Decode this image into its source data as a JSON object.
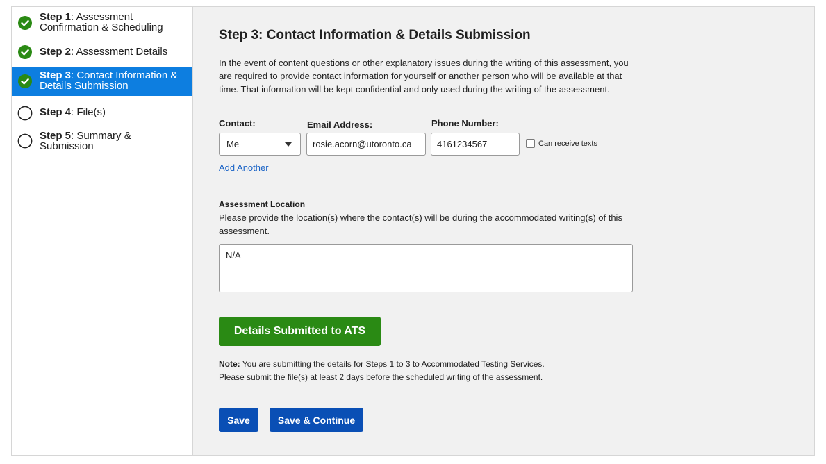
{
  "colors": {
    "active_step_bg": "#0d7ee0",
    "check_green": "#2a8a14",
    "primary_button": "#0a4fb5",
    "submitted_button": "#2a8a14",
    "link": "#1a63c6"
  },
  "sidebar": {
    "steps": [
      {
        "step": "Step 1",
        "rest": ": Assessment Confirmation & Scheduling",
        "status": "complete",
        "icon": "check-circle-icon"
      },
      {
        "step": "Step 2",
        "rest": ": Assessment Details",
        "status": "complete",
        "icon": "check-circle-icon"
      },
      {
        "step": "Step 3",
        "rest": ": Contact Information & Details Submission",
        "status": "active",
        "icon": "check-circle-icon"
      },
      {
        "step": "Step 4",
        "rest": ": File(s)",
        "status": "incomplete",
        "icon": "empty-circle-icon"
      },
      {
        "step": "Step 5",
        "rest": ": Summary & Submission",
        "status": "incomplete",
        "icon": "empty-circle-icon"
      }
    ]
  },
  "main": {
    "title": "Step 3: Contact Information & Details Submission",
    "intro": "In the event of content questions or other explanatory issues during the writing of this assessment, you are required to provide contact information for yourself or another person who will be available at that time. That information will be kept confidential and only used during the writing of the assessment.",
    "contact": {
      "label": "Contact:",
      "value": "Me"
    },
    "email": {
      "label": "Email Address:",
      "value": "rosie.acorn@utoronto.ca"
    },
    "phone": {
      "label": "Phone Number:",
      "value": "4161234567"
    },
    "texts_checkbox": {
      "label": "Can receive texts",
      "checked": false
    },
    "add_another": "Add Another",
    "location": {
      "heading": "Assessment Location",
      "description": "Please provide the location(s) where the contact(s) will be during the accommodated writing(s) of this assessment.",
      "value": "N/A"
    },
    "submitted_button": "Details Submitted to ATS",
    "note": {
      "bold": "Note:",
      "line1": " You are submitting the details for Steps 1 to 3 to Accommodated Testing Services.",
      "line2": "Please submit the file(s) at least 2 days before the scheduled writing of the assessment."
    },
    "save_button": "Save",
    "save_continue_button": "Save & Continue"
  }
}
